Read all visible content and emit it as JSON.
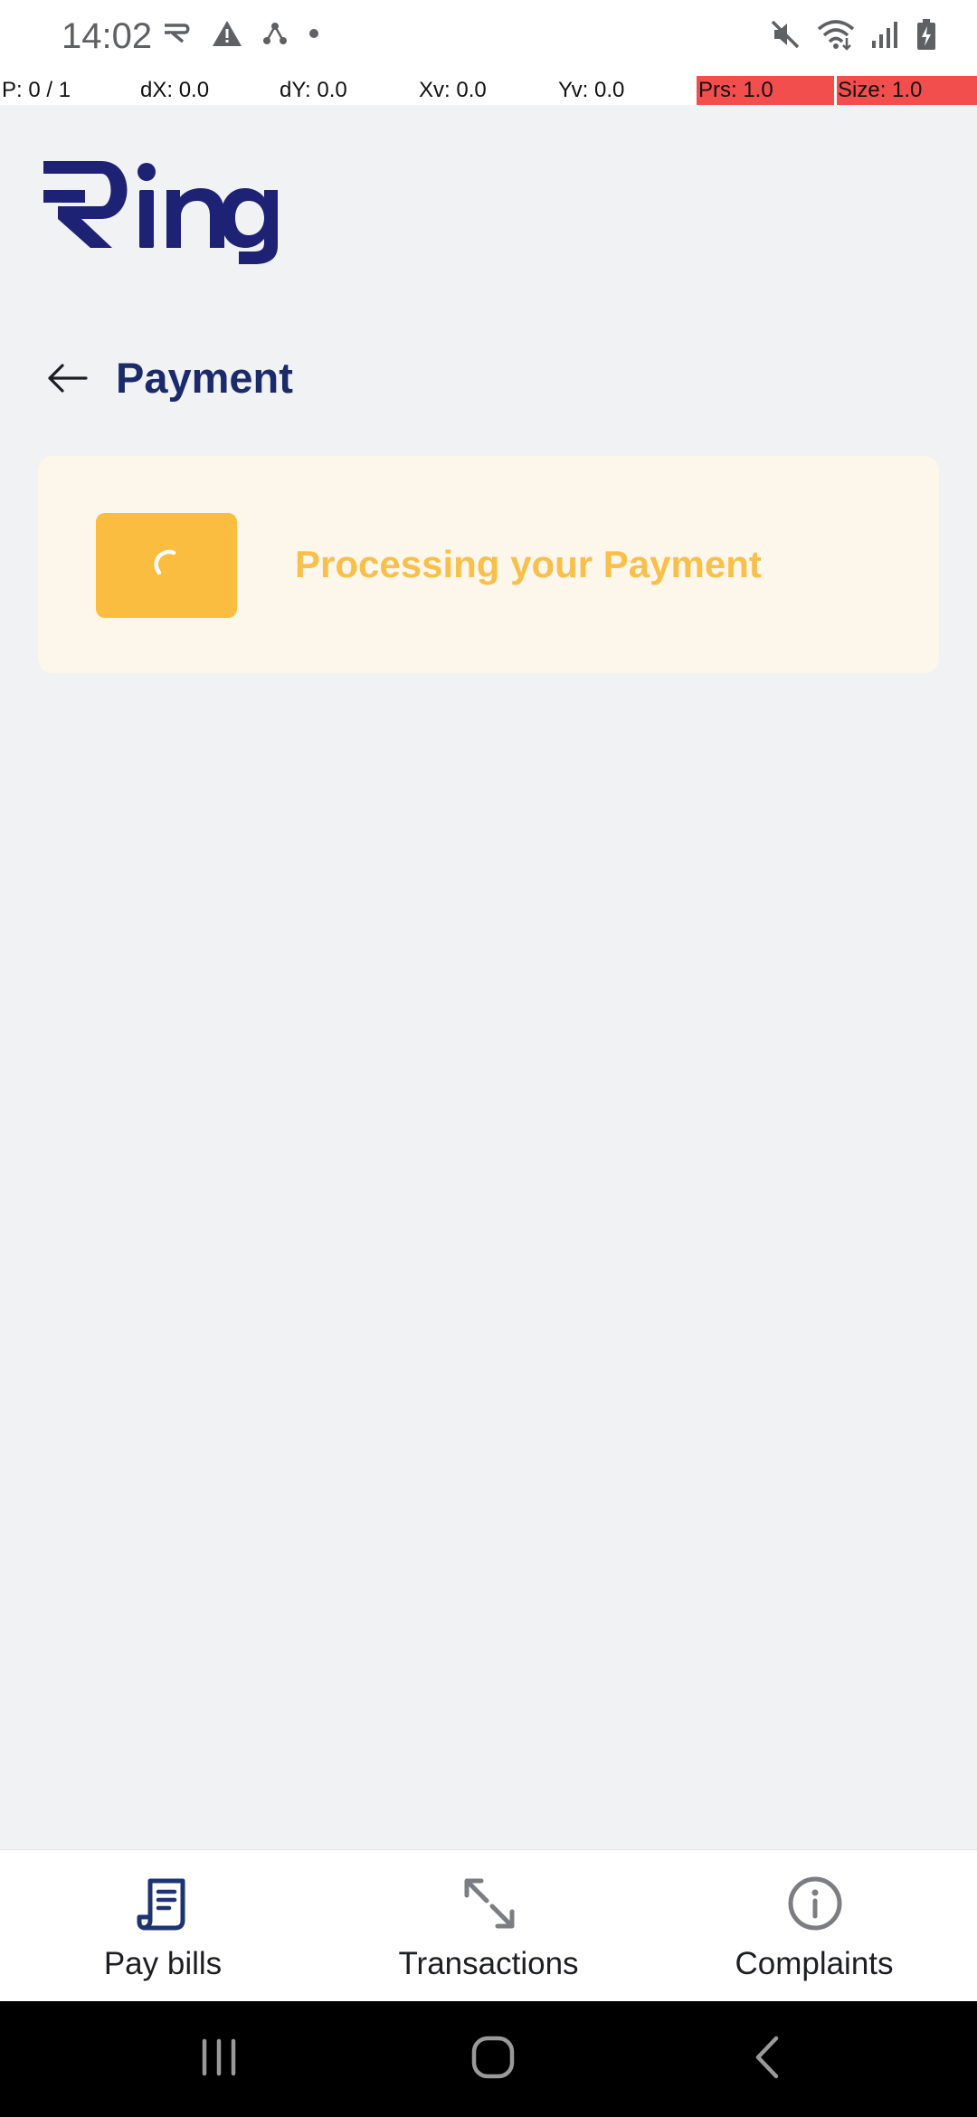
{
  "status_bar": {
    "time": "14:02"
  },
  "debug_bar": {
    "pointer": "P: 0 / 1",
    "dx": "dX: 0.0",
    "dy": "dY: 0.0",
    "xv": "Xv: 0.0",
    "yv": "Yv: 0.0",
    "prs": "Prs: 1.0",
    "size": "Size: 1.0"
  },
  "app": {
    "logo_text": "Ring",
    "brand_color": "#1e2275"
  },
  "header": {
    "title": "Payment",
    "back_icon": "arrow-left-icon"
  },
  "processing": {
    "message": "Processing your Payment",
    "spinner_icon": "spinner-icon",
    "accent_color": "#fbbd3f"
  },
  "bottom_nav": {
    "items": [
      {
        "label": "Pay bills",
        "icon": "receipt-icon",
        "active": true
      },
      {
        "label": "Transactions",
        "icon": "arrows-exchange-icon",
        "active": false
      },
      {
        "label": "Complaints",
        "icon": "info-circle-icon",
        "active": false
      }
    ]
  }
}
